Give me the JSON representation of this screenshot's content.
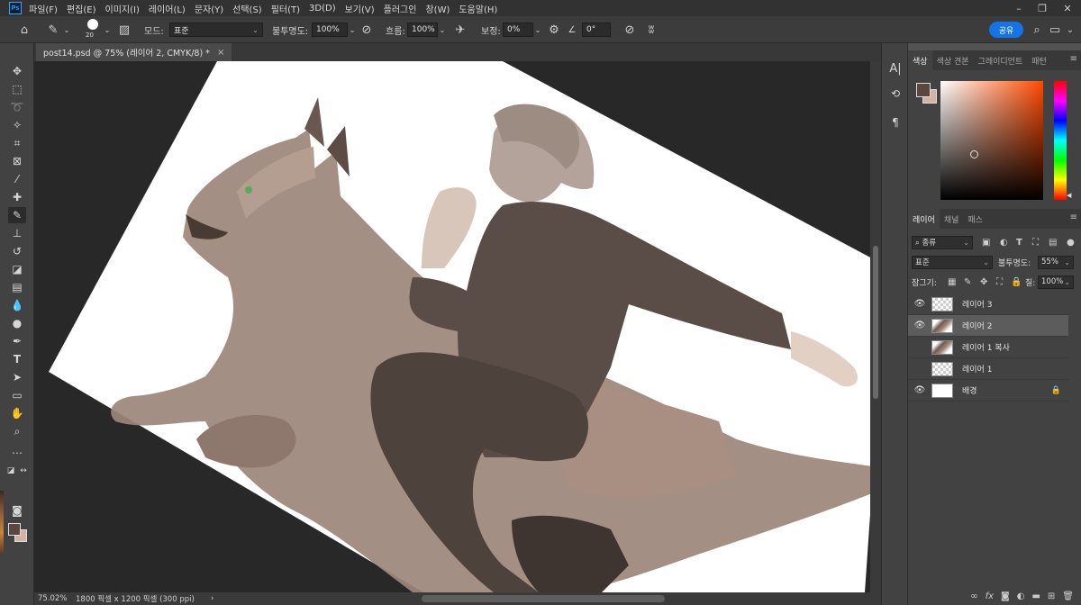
{
  "app": {
    "logo": "Ps"
  },
  "menu": [
    "파일(F)",
    "편집(E)",
    "이미지(I)",
    "레이어(L)",
    "문자(Y)",
    "선택(S)",
    "필터(T)",
    "3D(D)",
    "보기(V)",
    "플러그인",
    "창(W)",
    "도움말(H)"
  ],
  "options": {
    "brush_size": "20",
    "mode_label": "모드:",
    "mode_value": "표준",
    "opacity_label": "불투명도:",
    "opacity_value": "100%",
    "flow_label": "흐름:",
    "flow_value": "100%",
    "smoothing_label": "보정:",
    "smoothing_value": "0%",
    "angle_value": "0°",
    "share_label": "공유"
  },
  "document": {
    "tab_title": "post14.psd @ 75% (레이어 2, CMYK/8) *",
    "close_glyph": "×",
    "zoom": "75.02%",
    "size_info": "1800 픽셀 x 1200 픽셀 (300 ppi)",
    "status_arrow": "›"
  },
  "color_panel": {
    "tabs": [
      "색상",
      "색상 견본",
      "그레이디언트",
      "패턴"
    ],
    "foreground": "#5b473f",
    "background": "#d4b3a3"
  },
  "layers_panel": {
    "tabs": [
      "레이어",
      "채널",
      "패스"
    ],
    "filter_label": "종류",
    "blend_mode": "표준",
    "opacity_label": "불투명도:",
    "opacity_value": "55%",
    "lock_label": "잠그기:",
    "fill_label": "칠:",
    "fill_value": "100%",
    "layers": [
      {
        "name": "레이어 3",
        "visible": true,
        "selected": false,
        "thumb": "transparent"
      },
      {
        "name": "레이어 2",
        "visible": true,
        "selected": true,
        "thumb": "art"
      },
      {
        "name": "레이어 1 복사",
        "visible": false,
        "selected": false,
        "thumb": "art"
      },
      {
        "name": "레이어 1",
        "visible": false,
        "selected": false,
        "thumb": "transparent"
      },
      {
        "name": "배경",
        "visible": true,
        "selected": false,
        "thumb": "white",
        "locked": true
      }
    ]
  }
}
